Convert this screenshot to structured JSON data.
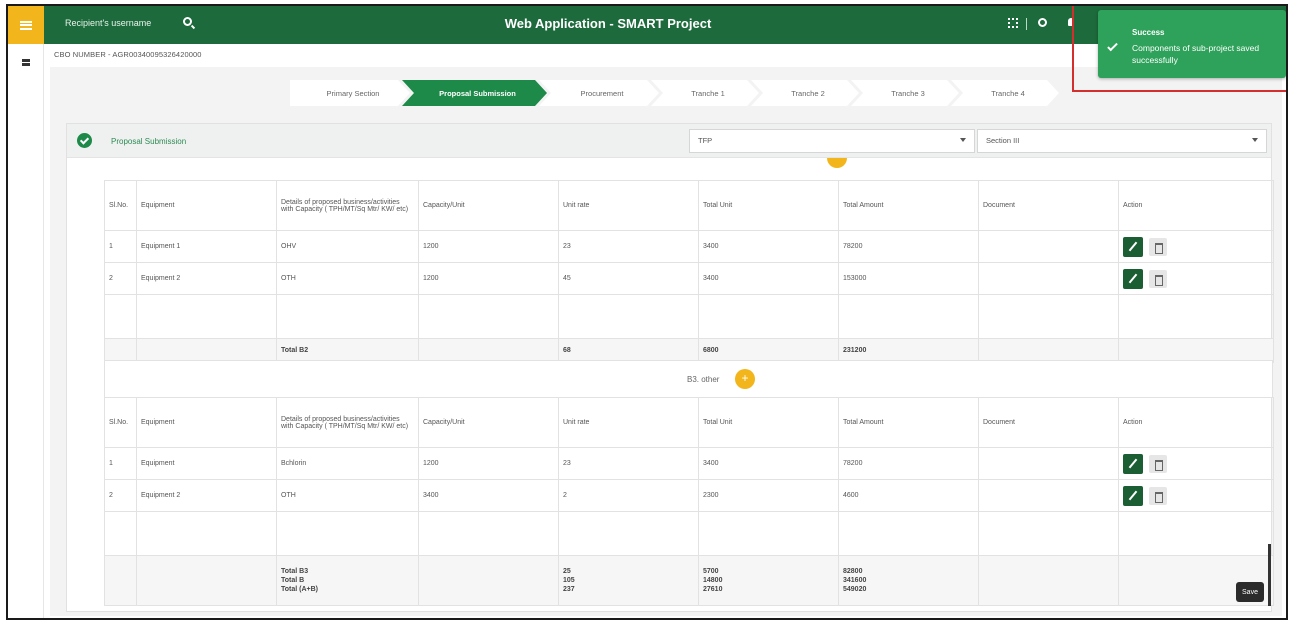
{
  "topbar": {
    "username": "Recipient's username",
    "title": "Web Application - SMART Project"
  },
  "cbo_number": "CBO NUMBER - AGR00340095326420000",
  "steps": [
    "Primary Section",
    "Proposal Submission",
    "Procurement",
    "Tranche 1",
    "Tranche 2",
    "Tranche 3",
    "Tranche 4"
  ],
  "panel": {
    "title": "Proposal Submission",
    "select_tfp": "TFP",
    "select_section": "Section III"
  },
  "columns": [
    "Sl.No.",
    "Equipment",
    "Details of proposed business/activities with Capacity ( TPH/MT/Sq Mtr/ KW/ etc)",
    "Capacity/Unit",
    "Unit rate",
    "Total Unit",
    "Total Amount",
    "Document",
    "Action"
  ],
  "table1": {
    "rows": [
      {
        "sl": "1",
        "equipment": "Equipment 1",
        "details": "OHV",
        "capacity": "1200",
        "unit_rate": "23",
        "total_unit": "3400",
        "total_amount": "78200",
        "document": ""
      },
      {
        "sl": "2",
        "equipment": "Equipment 2",
        "details": "OTH",
        "capacity": "1200",
        "unit_rate": "45",
        "total_unit": "3400",
        "total_amount": "153000",
        "document": ""
      }
    ],
    "total": {
      "label": "Total B2",
      "unit_rate": "68",
      "total_unit": "6800",
      "total_amount": "231200"
    }
  },
  "section_b3": {
    "title": "B3. other"
  },
  "table2": {
    "rows": [
      {
        "sl": "1",
        "equipment": "Equipment",
        "details": "Bchlorin",
        "capacity": "1200",
        "unit_rate": "23",
        "total_unit": "3400",
        "total_amount": "78200",
        "document": ""
      },
      {
        "sl": "2",
        "equipment": "Equipment 2",
        "details": "OTH",
        "capacity": "3400",
        "unit_rate": "2",
        "total_unit": "2300",
        "total_amount": "4600",
        "document": ""
      }
    ],
    "totals": {
      "labels": [
        "Total B3",
        "Total B",
        "Total (A+B)"
      ],
      "unit_rate": [
        "25",
        "105",
        "237"
      ],
      "total_unit": [
        "5700",
        "14800",
        "27610"
      ],
      "total_amount": [
        "82800",
        "341600",
        "549020"
      ]
    }
  },
  "save_label": "Save",
  "toast": {
    "title": "Success",
    "message": "Components of sub-project saved successfully"
  },
  "colors": {
    "primary": "#1d6b3c",
    "accent": "#f2b61c",
    "toast": "#2ea15a",
    "highlight": "#d32f2f"
  }
}
